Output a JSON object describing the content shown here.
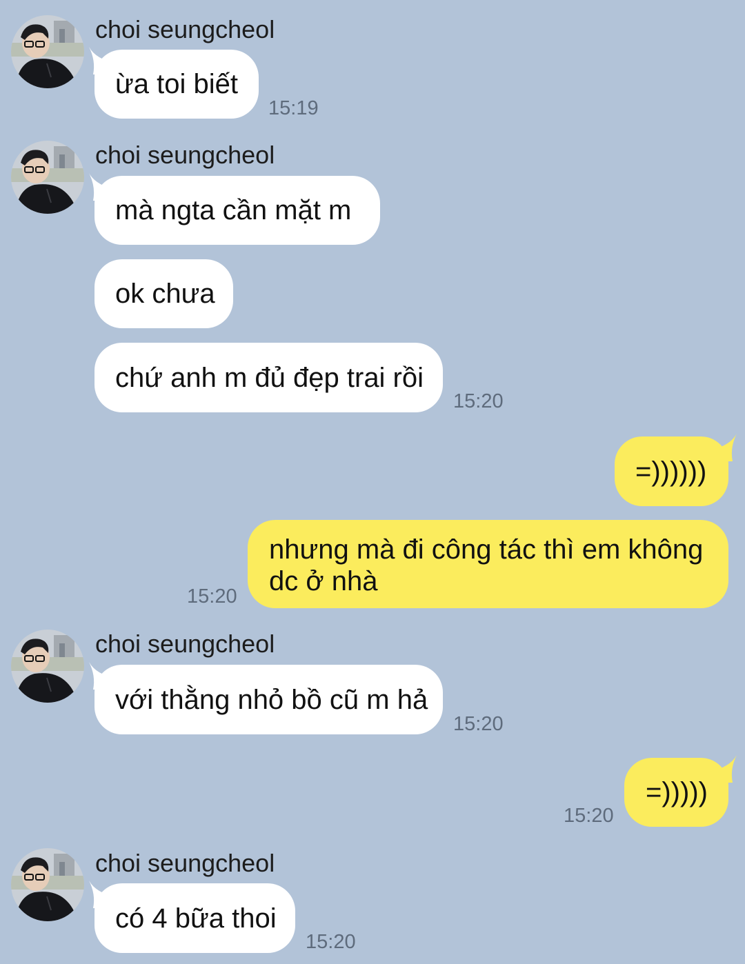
{
  "contact": {
    "name": "choi seungcheol"
  },
  "colors": {
    "background": "#b2c3d8",
    "incoming_bubble": "#ffffff",
    "outgoing_bubble": "#fbec5d",
    "timestamp": "#5e6b7c"
  },
  "messages": [
    {
      "from": "contact",
      "show_name": true,
      "text": "ừa toi biết",
      "time": "15:19"
    },
    {
      "from": "contact",
      "show_name": true,
      "text": "mà ngta cần mặt m",
      "time": ""
    },
    {
      "from": "contact",
      "show_name": false,
      "text": "ok chưa",
      "time": ""
    },
    {
      "from": "contact",
      "show_name": false,
      "text": "chứ anh m đủ đẹp trai rồi",
      "time": "15:20"
    },
    {
      "from": "me",
      "text": "=))))))",
      "time": ""
    },
    {
      "from": "me",
      "text_lines": [
        "nhưng mà đi công tác thì em không",
        "dc ở nhà"
      ],
      "time": "15:20"
    },
    {
      "from": "contact",
      "show_name": true,
      "text": "với thằng nhỏ bồ cũ m hả",
      "time": "15:20"
    },
    {
      "from": "me",
      "text": "=)))))",
      "time": "15:20"
    },
    {
      "from": "contact",
      "show_name": true,
      "text": "có 4 bữa thoi",
      "time": "15:20"
    }
  ]
}
